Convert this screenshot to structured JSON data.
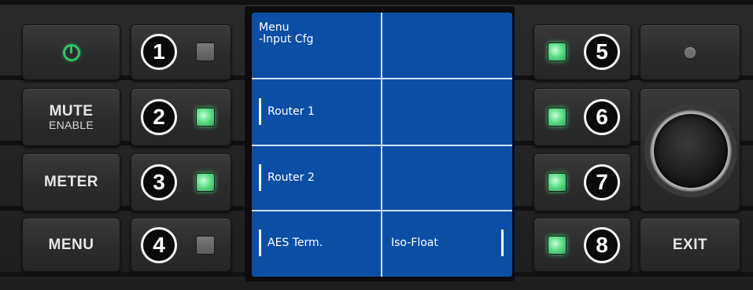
{
  "left_buttons": {
    "power_icon": "power-icon",
    "mute_label": "MUTE",
    "mute_sub": "ENABLE",
    "meter_label": "METER",
    "menu_label": "MENU"
  },
  "left_softkeys": [
    {
      "number": "1",
      "led": "off"
    },
    {
      "number": "2",
      "led": "on"
    },
    {
      "number": "3",
      "led": "on"
    },
    {
      "number": "4",
      "led": "off"
    }
  ],
  "right_softkeys": [
    {
      "number": "5",
      "led": "on"
    },
    {
      "number": "6",
      "led": "on"
    },
    {
      "number": "7",
      "led": "on"
    },
    {
      "number": "8",
      "led": "on"
    }
  ],
  "screen": {
    "title_line1": "Menu",
    "title_line2": "-Input Cfg",
    "row2_left": "Router 1",
    "row3_left": "Router 2",
    "row4_left": "AES Term.",
    "row4_right": "Iso-Float",
    "background_color": "#0c4ea6"
  },
  "right_controls": {
    "status_icon": "status-led-icon",
    "knob_icon": "rotary-knob-icon",
    "exit_label": "EXIT"
  },
  "colors": {
    "led_on": "#5fe08a",
    "led_off": "#6a6a6a",
    "power_green": "#2fc36a"
  }
}
